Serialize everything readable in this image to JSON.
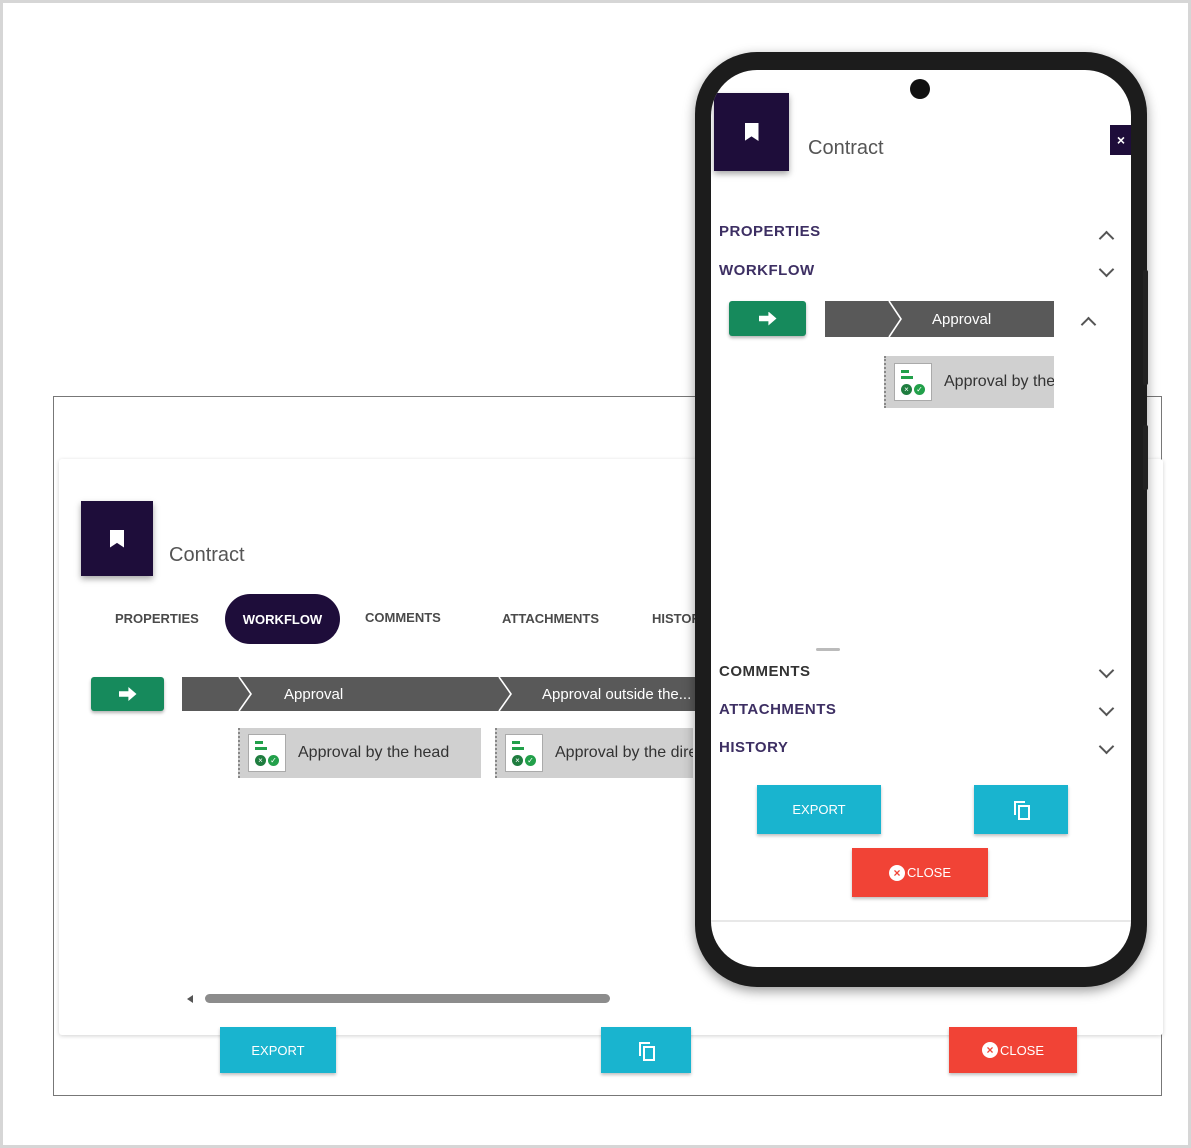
{
  "desktop": {
    "title": "Contract",
    "tabs": [
      "PROPERTIES",
      "WORKFLOW",
      "COMMENTS",
      "ATTACHMENTS",
      "HISTORY"
    ],
    "active_tab": "WORKFLOW",
    "stages": [
      "Approval",
      "Approval outside the..."
    ],
    "tasks": [
      "Approval by the head",
      "Approval by the director"
    ],
    "buttons": {
      "export": "EXPORT",
      "close": "CLOSE"
    }
  },
  "mobile": {
    "title": "Contract",
    "close_glyph": "×",
    "sections": {
      "properties": "PROPERTIES",
      "workflow": "WORKFLOW",
      "comments": "COMMENTS",
      "attachments": "ATTACHMENTS",
      "history": "HISTORY"
    },
    "stage": "Approval",
    "task": "Approval by the head",
    "buttons": {
      "export": "EXPORT",
      "close": "CLOSE"
    }
  },
  "colors": {
    "brand_dark": "#1e0d3a",
    "go_green": "#168a5c",
    "stage_gray": "#595959",
    "export_cyan": "#19b4cf",
    "close_red": "#f14336"
  },
  "icons": [
    "bookmark-icon",
    "arrow-right-icon",
    "task-approval-icon",
    "copy-icon",
    "close-circle-icon",
    "chevron-up-icon",
    "chevron-down-icon"
  ]
}
